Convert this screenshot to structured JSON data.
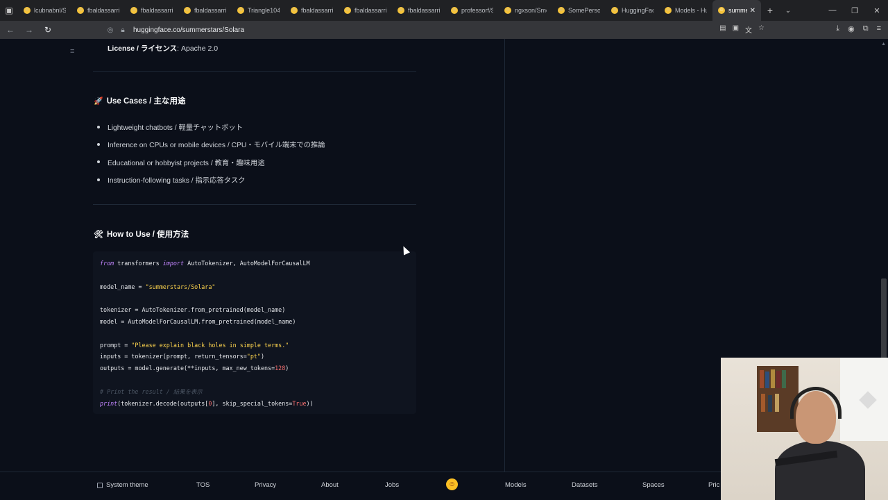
{
  "browser": {
    "tabs": [
      {
        "title": "lcubnabnl/Sm"
      },
      {
        "title": "fbaldassarri/I"
      },
      {
        "title": "fbaldassarri/I"
      },
      {
        "title": "fbaldassarri/I"
      },
      {
        "title": "Triangle104/S"
      },
      {
        "title": "fbaldassarri/I"
      },
      {
        "title": "fbaldassarri/I"
      },
      {
        "title": "fbaldassarri/I"
      },
      {
        "title": "professorf/Sr"
      },
      {
        "title": "ngxson/Smoll"
      },
      {
        "title": "SomePersonA"
      },
      {
        "title": "HuggingFace"
      },
      {
        "title": "Models - Hug"
      }
    ],
    "active_tab": "summersta",
    "url": "huggingface.co/summerstars/Solara",
    "new_tab_glyph": "+",
    "close_glyph": "✕"
  },
  "content": {
    "license_label": "License / ライセンス",
    "license_value": ": Apache 2.0",
    "use_cases": {
      "emoji": "🚀",
      "title": "Use Cases / 主な用途",
      "items": [
        "Lightweight chatbots / 軽量チャットボット",
        "Inference on CPUs or mobile devices / CPU・モバイル端末での推論",
        "Educational or hobbyist projects / 教育・趣味用途",
        "Instruction-following tasks / 指示応答タスク"
      ]
    },
    "how_to_use": {
      "emoji": "🛠",
      "title": "How to Use / 使用方法"
    },
    "code": {
      "l1_kw1": "from",
      "l1_mid": " transformers ",
      "l1_kw2": "import",
      "l1_end": " AutoTokenizer, AutoModelForCausalLM",
      "l2_pre": "model_name = ",
      "l2_str": "\"summerstars/Solara\"",
      "l3": "tokenizer = AutoTokenizer.from_pretrained(model_name)",
      "l4": "model = AutoModelForCausalLM.from_pretrained(model_name)",
      "l5_pre": "prompt = ",
      "l5_str": "\"Please explain black holes in simple terms.\"",
      "l6_pre": "inputs = tokenizer(prompt, return_tensors=",
      "l6_str": "\"pt\"",
      "l6_end": ")",
      "l7_pre": "outputs = model.generate(**inputs, max_new_tokens=",
      "l7_num": "128",
      "l7_end": ")",
      "l8_com": "# Print the result / 結果を表示",
      "l9_kw": "print",
      "l9_mid": "(tokenizer.decode(outputs[",
      "l9_num": "0",
      "l9_mid2": "], skip_special_tokens=",
      "l9_true": "True",
      "l9_end": "))"
    }
  },
  "footer": {
    "system_theme": "System theme",
    "tos": "TOS",
    "privacy": "Privacy",
    "about": "About",
    "jobs": "Jobs",
    "models": "Models",
    "datasets": "Datasets",
    "spaces": "Spaces",
    "pricing": "Pric"
  },
  "colors": {
    "page_bg": "#0b0f19",
    "code_keyword": "#c084fc",
    "code_string": "#fcd34d",
    "code_number": "#f87171",
    "hf_yellow": "#fbbf24"
  }
}
